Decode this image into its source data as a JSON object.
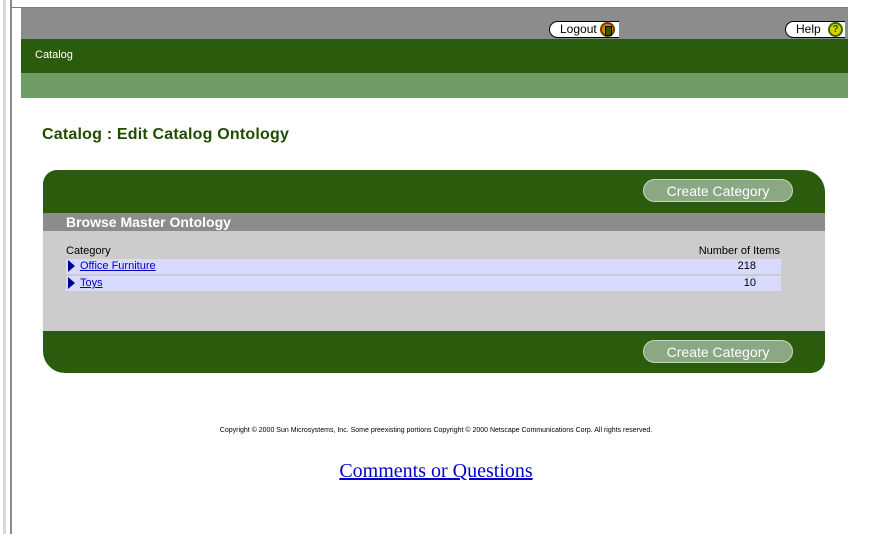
{
  "header": {
    "logout_label": "Logout",
    "help_label": "Help",
    "help_icon_glyph": "?",
    "nav_item": "Catalog"
  },
  "page": {
    "title": "Catalog : Edit Catalog Ontology"
  },
  "panel": {
    "create_category_label": "Create Category",
    "section_title": "Browse Master Ontology",
    "columns": {
      "category": "Category",
      "count": "Number of Items"
    },
    "rows": [
      {
        "category": "Office Furniture",
        "count": "218"
      },
      {
        "category": "Toys",
        "count": "10"
      }
    ]
  },
  "footer": {
    "copyright": "Copyright © 2000 Sun Microsystems, Inc. Some preexisting portions Copyright © 2000 Netscape Communications Corp. All rights reserved.",
    "comments_link": "Comments or Questions"
  },
  "colors": {
    "dark_green": "#2b5b0c",
    "light_green": "#6f9b64",
    "gray_bar": "#8c8c8c",
    "row_highlight": "#d9daff",
    "link_blue": "#0000cc"
  },
  "icons": [
    "logout-icon",
    "help-icon",
    "expand-arrow-icon"
  ]
}
